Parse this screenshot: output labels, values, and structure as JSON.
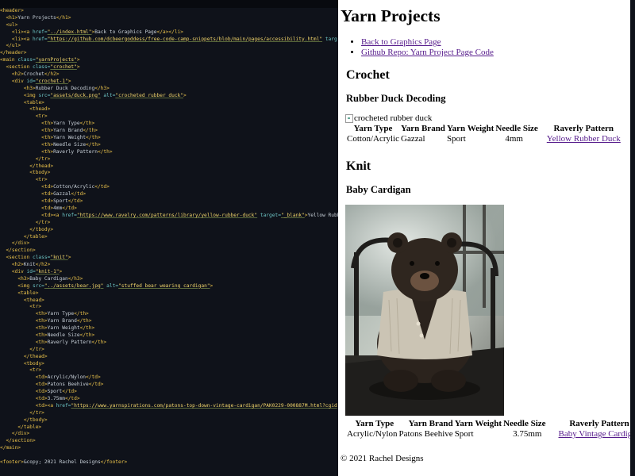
{
  "editor": {
    "lines": [
      [
        [
          "t",
          "<header>"
        ]
      ],
      [
        [
          "x",
          "  "
        ],
        [
          "t",
          "<h1>"
        ],
        [
          "x",
          "Yarn Projects"
        ],
        [
          "t",
          "</h1>"
        ]
      ],
      [
        [
          "x",
          "  "
        ],
        [
          "t",
          "<ul>"
        ]
      ],
      [
        [
          "x",
          "    "
        ],
        [
          "t",
          "<li><a "
        ],
        [
          "a",
          "href="
        ],
        [
          "s",
          "\"../index.html\""
        ],
        [
          "t",
          ">"
        ],
        [
          "x",
          "Back to Graphics Page"
        ],
        [
          "t",
          "</a></li>"
        ]
      ],
      [
        [
          "x",
          "    "
        ],
        [
          "t",
          "<li><a "
        ],
        [
          "a",
          "href="
        ],
        [
          "s",
          "\"https://github.com/dcbeergoddess/free-code-camp-snippets/blob/main/pages/accessibility.html\""
        ],
        [
          "a",
          " targ"
        ]
      ],
      [
        [
          "x",
          "  "
        ],
        [
          "t",
          "</ul>"
        ]
      ],
      [
        [
          "t",
          "</header>"
        ]
      ],
      [
        [
          "t",
          "<main "
        ],
        [
          "a",
          "class="
        ],
        [
          "s",
          "\"yarnProjects\""
        ],
        [
          "t",
          ">"
        ]
      ],
      [
        [
          "x",
          "  "
        ],
        [
          "t",
          "<section "
        ],
        [
          "a",
          "class="
        ],
        [
          "s",
          "\"crochet\""
        ],
        [
          "t",
          ">"
        ]
      ],
      [
        [
          "x",
          "    "
        ],
        [
          "t",
          "<h2>"
        ],
        [
          "x",
          "Crochet"
        ],
        [
          "t",
          "</h2>"
        ]
      ],
      [
        [
          "x",
          "    "
        ],
        [
          "t",
          "<div "
        ],
        [
          "a",
          "id="
        ],
        [
          "s",
          "\"crochet-1\""
        ],
        [
          "t",
          ">"
        ]
      ],
      [
        [
          "x",
          "        "
        ],
        [
          "t",
          "<h3>"
        ],
        [
          "x",
          "Rubber Duck Decoding"
        ],
        [
          "t",
          "</h3>"
        ]
      ],
      [
        [
          "x",
          "        "
        ],
        [
          "t",
          "<img "
        ],
        [
          "a",
          "src="
        ],
        [
          "s",
          "\"assets/duck.png\""
        ],
        [
          "a",
          " alt="
        ],
        [
          "s",
          "\"crocheted rubber duck\""
        ],
        [
          "t",
          ">"
        ]
      ],
      [
        [
          "x",
          "        "
        ],
        [
          "t",
          "<table>"
        ]
      ],
      [
        [
          "x",
          "          "
        ],
        [
          "t",
          "<thead>"
        ]
      ],
      [
        [
          "x",
          "            "
        ],
        [
          "t",
          "<tr>"
        ]
      ],
      [
        [
          "x",
          "              "
        ],
        [
          "t",
          "<th>"
        ],
        [
          "x",
          "Yarn Type"
        ],
        [
          "t",
          "</th>"
        ]
      ],
      [
        [
          "x",
          "              "
        ],
        [
          "t",
          "<th>"
        ],
        [
          "x",
          "Yarn Brand"
        ],
        [
          "t",
          "</th>"
        ]
      ],
      [
        [
          "x",
          "              "
        ],
        [
          "t",
          "<th>"
        ],
        [
          "x",
          "Yarn Weight"
        ],
        [
          "t",
          "</th>"
        ]
      ],
      [
        [
          "x",
          "              "
        ],
        [
          "t",
          "<th>"
        ],
        [
          "x",
          "Needle Size"
        ],
        [
          "t",
          "</th>"
        ]
      ],
      [
        [
          "x",
          "              "
        ],
        [
          "t",
          "<th>"
        ],
        [
          "x",
          "Raverly Pattern"
        ],
        [
          "t",
          "</th>"
        ]
      ],
      [
        [
          "x",
          "            "
        ],
        [
          "t",
          "</tr>"
        ]
      ],
      [
        [
          "x",
          "          "
        ],
        [
          "t",
          "</thead>"
        ]
      ],
      [
        [
          "x",
          "          "
        ],
        [
          "t",
          "<tbody>"
        ]
      ],
      [
        [
          "x",
          "            "
        ],
        [
          "t",
          "<tr>"
        ]
      ],
      [
        [
          "x",
          "              "
        ],
        [
          "t",
          "<td>"
        ],
        [
          "x",
          "Cotton/Acrylic"
        ],
        [
          "t",
          "</td>"
        ]
      ],
      [
        [
          "x",
          "              "
        ],
        [
          "t",
          "<td>"
        ],
        [
          "x",
          "Gazzal"
        ],
        [
          "t",
          "</td>"
        ]
      ],
      [
        [
          "x",
          "              "
        ],
        [
          "t",
          "<td>"
        ],
        [
          "x",
          "Sport"
        ],
        [
          "t",
          "</td>"
        ]
      ],
      [
        [
          "x",
          "              "
        ],
        [
          "t",
          "<td>"
        ],
        [
          "x",
          "4mm"
        ],
        [
          "t",
          "</td>"
        ]
      ],
      [
        [
          "x",
          "              "
        ],
        [
          "t",
          "<td><a "
        ],
        [
          "a",
          "href="
        ],
        [
          "s",
          "\"https://www.ravelry.com/patterns/library/yellow-rubber-duck\""
        ],
        [
          "a",
          " target="
        ],
        [
          "s",
          "\"_blank\""
        ],
        [
          "t",
          ">"
        ],
        [
          "x",
          "Yellow Rubb"
        ]
      ],
      [
        [
          "x",
          "            "
        ],
        [
          "t",
          "</tr>"
        ]
      ],
      [
        [
          "x",
          "          "
        ],
        [
          "t",
          "</tbody>"
        ]
      ],
      [
        [
          "x",
          "        "
        ],
        [
          "t",
          "</table>"
        ]
      ],
      [
        [
          "x",
          "    "
        ],
        [
          "t",
          "</div>"
        ]
      ],
      [
        [
          "x",
          "  "
        ],
        [
          "t",
          "</section>"
        ]
      ],
      [
        [
          "x",
          "  "
        ],
        [
          "t",
          "<section "
        ],
        [
          "a",
          "class="
        ],
        [
          "s",
          "\"knit\""
        ],
        [
          "t",
          ">"
        ]
      ],
      [
        [
          "x",
          "    "
        ],
        [
          "t",
          "<h2>"
        ],
        [
          "x",
          "Knit"
        ],
        [
          "t",
          "</h2>"
        ]
      ],
      [
        [
          "x",
          "    "
        ],
        [
          "t",
          "<div "
        ],
        [
          "a",
          "id="
        ],
        [
          "s",
          "\"knit-1\""
        ],
        [
          "t",
          ">"
        ]
      ],
      [
        [
          "x",
          "      "
        ],
        [
          "t",
          "<h3>"
        ],
        [
          "x",
          "Baby Cardigan"
        ],
        [
          "t",
          "</h3>"
        ]
      ],
      [
        [
          "x",
          "      "
        ],
        [
          "t",
          "<img "
        ],
        [
          "a",
          "src="
        ],
        [
          "s",
          "\"../assets/bear.jpg\""
        ],
        [
          "a",
          " alt="
        ],
        [
          "s",
          "\"stuffed bear wearing cardigan\""
        ],
        [
          "t",
          ">"
        ]
      ],
      [
        [
          "x",
          "      "
        ],
        [
          "t",
          "<table>"
        ]
      ],
      [
        [
          "x",
          "        "
        ],
        [
          "t",
          "<thead>"
        ]
      ],
      [
        [
          "x",
          "          "
        ],
        [
          "t",
          "<tr>"
        ]
      ],
      [
        [
          "x",
          "            "
        ],
        [
          "t",
          "<th>"
        ],
        [
          "x",
          "Yarn Type"
        ],
        [
          "t",
          "</th>"
        ]
      ],
      [
        [
          "x",
          "            "
        ],
        [
          "t",
          "<th>"
        ],
        [
          "x",
          "Yarn Brand"
        ],
        [
          "t",
          "</th>"
        ]
      ],
      [
        [
          "x",
          "            "
        ],
        [
          "t",
          "<th>"
        ],
        [
          "x",
          "Yarn Weight"
        ],
        [
          "t",
          "</th>"
        ]
      ],
      [
        [
          "x",
          "            "
        ],
        [
          "t",
          "<th>"
        ],
        [
          "x",
          "Needle Size"
        ],
        [
          "t",
          "</th>"
        ]
      ],
      [
        [
          "x",
          "            "
        ],
        [
          "t",
          "<th>"
        ],
        [
          "x",
          "Raverly Pattern"
        ],
        [
          "t",
          "</th>"
        ]
      ],
      [
        [
          "x",
          "          "
        ],
        [
          "t",
          "</tr>"
        ]
      ],
      [
        [
          "x",
          "        "
        ],
        [
          "t",
          "</thead>"
        ]
      ],
      [
        [
          "x",
          "        "
        ],
        [
          "t",
          "<tbody>"
        ]
      ],
      [
        [
          "x",
          "          "
        ],
        [
          "t",
          "<tr>"
        ]
      ],
      [
        [
          "x",
          "            "
        ],
        [
          "t",
          "<td>"
        ],
        [
          "x",
          "Acrylic/Nylon"
        ],
        [
          "t",
          "</td>"
        ]
      ],
      [
        [
          "x",
          "            "
        ],
        [
          "t",
          "<td>"
        ],
        [
          "x",
          "Patons Beehive"
        ],
        [
          "t",
          "</td>"
        ]
      ],
      [
        [
          "x",
          "            "
        ],
        [
          "t",
          "<td>"
        ],
        [
          "x",
          "Sport"
        ],
        [
          "t",
          "</td>"
        ]
      ],
      [
        [
          "x",
          "            "
        ],
        [
          "t",
          "<td>"
        ],
        [
          "x",
          "3.75mm"
        ],
        [
          "t",
          "</td>"
        ]
      ],
      [
        [
          "x",
          "            "
        ],
        [
          "t",
          "<td><a "
        ],
        [
          "a",
          "href="
        ],
        [
          "s",
          "\"https://www.yarnspirations.com/patons-top-down-vintage-cardigan/PAK0229-000887M.html?cgid"
        ]
      ],
      [
        [
          "x",
          "          "
        ],
        [
          "t",
          "</tr>"
        ]
      ],
      [
        [
          "x",
          "        "
        ],
        [
          "t",
          "</tbody>"
        ]
      ],
      [
        [
          "x",
          "      "
        ],
        [
          "t",
          "</table>"
        ]
      ],
      [
        [
          "x",
          "    "
        ],
        [
          "t",
          "</div>"
        ]
      ],
      [
        [
          "x",
          "  "
        ],
        [
          "t",
          "</section>"
        ]
      ],
      [
        [
          "t",
          "</main>"
        ]
      ],
      [
        [
          "x",
          ""
        ]
      ],
      [
        [
          "t",
          "<footer>"
        ],
        [
          "x",
          "&copy; 2021 Rachel Designs"
        ],
        [
          "t",
          "</footer>"
        ]
      ]
    ]
  },
  "preview": {
    "title": "Yarn Projects",
    "nav": [
      {
        "label": "Back to Graphics Page"
      },
      {
        "label": "Github Repo: Yarn Project Page Code"
      }
    ],
    "crochet": {
      "heading": "Crochet",
      "project_title": "Rubber Duck Decoding",
      "image_alt": "crocheted rubber duck",
      "headers": [
        "Yarn Type",
        "Yarn Brand",
        "Yarn Weight",
        "Needle Size",
        "Raverly Pattern"
      ],
      "row": {
        "yarn_type": "Cotton/Acrylic",
        "brand": "Gazzal",
        "weight": "Sport",
        "needle": "4mm",
        "pattern": "Yellow Rubber Duck"
      }
    },
    "knit": {
      "heading": "Knit",
      "project_title": "Baby Cardigan",
      "headers": [
        "Yarn Type",
        "Yarn Brand",
        "Yarn Weight",
        "Needle Size",
        "Raverly Pattern"
      ],
      "row": {
        "yarn_type": "Acrylic/Nylon",
        "brand": "Patons Beehive",
        "weight": "Sport",
        "needle": "3.75mm",
        "pattern": "Baby Vintage Cardigan"
      }
    },
    "footer": "© 2021 Rachel Designs"
  },
  "colors": {
    "editor_bg": "#0f121a",
    "tag": "#e8c04a",
    "attr": "#6cc4c4",
    "string": "#f2d56b",
    "link_visited": "#551a8b"
  }
}
